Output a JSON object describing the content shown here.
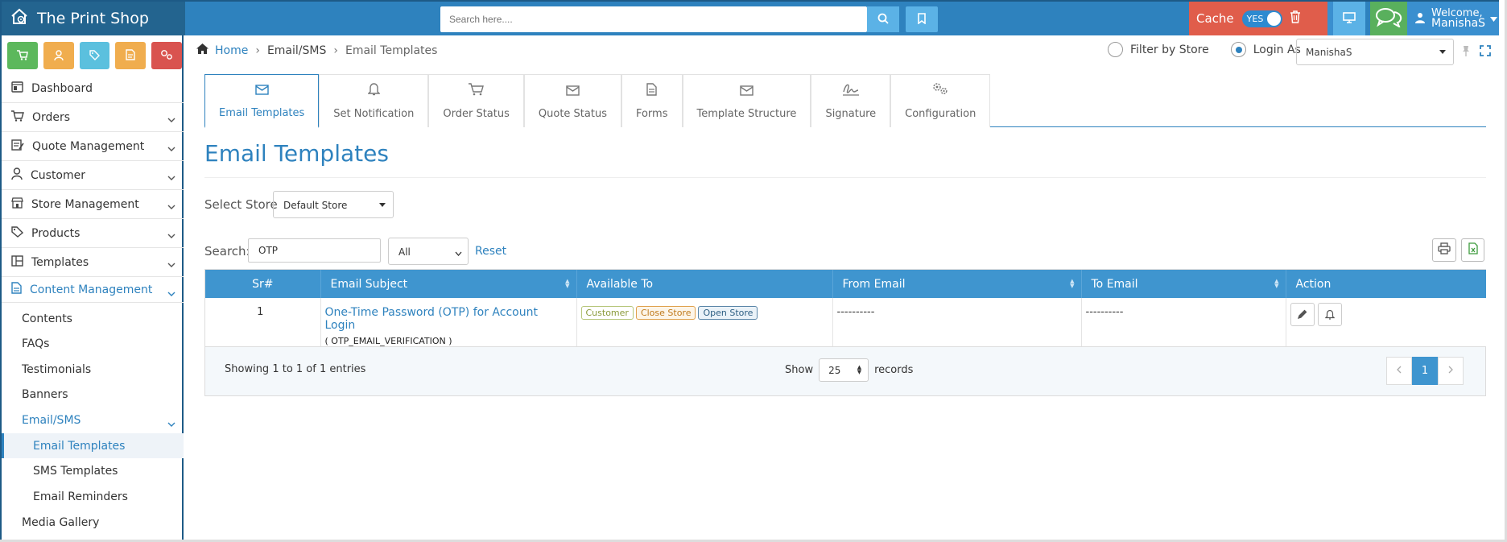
{
  "app": {
    "title": "The Print Shop"
  },
  "topbar": {
    "search_placeholder": "Search here....",
    "cache_label": "Cache",
    "cache_toggle": "YES",
    "welcome_line1": "Welcome,",
    "welcome_line2": "ManishaS"
  },
  "sidebar": {
    "items": [
      {
        "label": "Dashboard",
        "icon": "dashboard-icon"
      },
      {
        "label": "Orders",
        "icon": "cart-icon"
      },
      {
        "label": "Quote Management",
        "icon": "quote-icon"
      },
      {
        "label": "Customer",
        "icon": "user-icon"
      },
      {
        "label": "Store Management",
        "icon": "store-icon"
      },
      {
        "label": "Products",
        "icon": "tag-icon"
      },
      {
        "label": "Templates",
        "icon": "template-icon"
      },
      {
        "label": "Content Management",
        "icon": "document-icon"
      }
    ],
    "sub_items": [
      "Contents",
      "FAQs",
      "Testimonials",
      "Banners",
      "Email/SMS"
    ],
    "sub_sub_items": [
      "Email Templates",
      "SMS Templates",
      "Email Reminders"
    ],
    "media": "Media Gallery"
  },
  "breadcrumb": {
    "home": "Home",
    "section": "Email/SMS",
    "current": "Email Templates"
  },
  "filter": {
    "by_store": "Filter by Store",
    "login_as": "Login As",
    "user": "ManishaS"
  },
  "tabs": [
    "Email Templates",
    "Set Notification",
    "Order Status",
    "Quote Status",
    "Forms",
    "Template Structure",
    "Signature",
    "Configuration"
  ],
  "page": {
    "title": "Email Templates",
    "select_store_label": "Select Store",
    "store_value": "Default Store",
    "search_label": "Search:",
    "search_value": "OTP",
    "filter_value": "All",
    "reset": "Reset"
  },
  "table": {
    "headers": [
      "Sr#",
      "Email Subject",
      "Available To",
      "From Email",
      "To Email",
      "Action"
    ],
    "rows": [
      {
        "sr": "1",
        "subject": "One-Time Password (OTP) for Account Login",
        "code": "( OTP_EMAIL_VERIFICATION )",
        "available": [
          "Customer",
          "Close Store",
          "Open Store"
        ],
        "from": "----------",
        "to": "----------"
      }
    ],
    "info": "Showing 1 to 1 of 1 entries",
    "show": "Show",
    "page_length": "25",
    "records": "records",
    "current_page": "1"
  }
}
